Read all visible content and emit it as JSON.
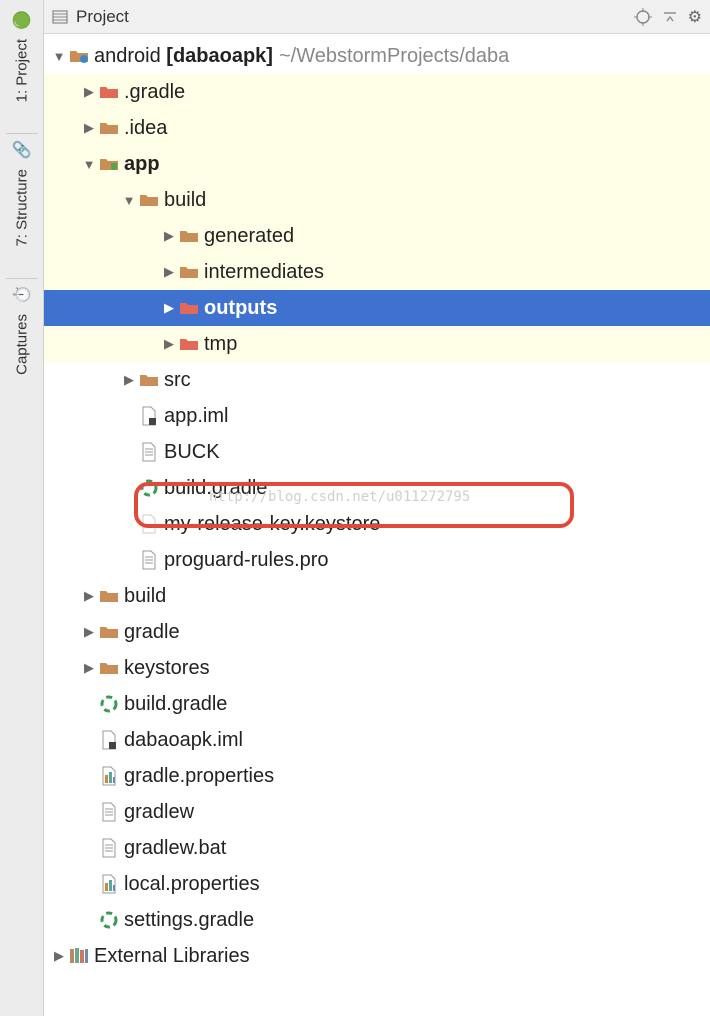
{
  "toolbar": {
    "label": "Project"
  },
  "leftRail": {
    "items": [
      {
        "label": "1: Project"
      },
      {
        "label": "7: Structure"
      },
      {
        "label": "Captures"
      }
    ]
  },
  "root": {
    "name": "android",
    "module": "[dabaoapk]",
    "path": "~/WebstormProjects/daba"
  },
  "tree": {
    "gradle": ".gradle",
    "idea": ".idea",
    "app": "app",
    "build": "build",
    "generated": "generated",
    "intermediates": "intermediates",
    "outputs": "outputs",
    "tmp": "tmp",
    "src": "src",
    "appIml": "app.iml",
    "buck": "BUCK",
    "buildGradle": "build.gradle",
    "keystore": "my-release-key.keystore",
    "proguard": "proguard-rules.pro",
    "rootBuild": "build",
    "rootGradle": "gradle",
    "keystores": "keystores",
    "rootBuildGradle": "build.gradle",
    "dabaoapkIml": "dabaoapk.iml",
    "gradleProps": "gradle.properties",
    "gradlew": "gradlew",
    "gradlewBat": "gradlew.bat",
    "localProps": "local.properties",
    "settingsGradle": "settings.gradle",
    "extLib": "External Libraries"
  },
  "watermark": "http://blog.csdn.net/u011272795"
}
